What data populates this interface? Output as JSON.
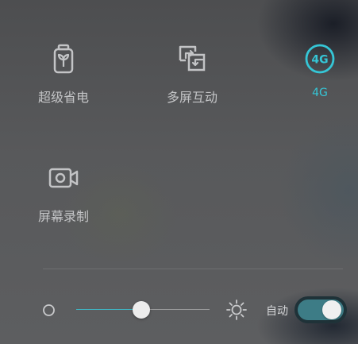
{
  "quick_settings": {
    "tiles": [
      {
        "label": "超级省电",
        "icon": "battery-leaf-icon",
        "active": false
      },
      {
        "label": "多屏互动",
        "icon": "screen-mirror-icon",
        "active": false
      },
      {
        "label": "4G",
        "icon": "4g-network-icon",
        "active": true
      },
      {
        "label": "屏幕录制",
        "icon": "screen-record-icon",
        "active": false
      }
    ],
    "active_color": "#35c6d6"
  },
  "brightness": {
    "level": 0.49,
    "auto_label": "自动",
    "auto_enabled": true,
    "low_icon": "brightness-low-icon",
    "high_icon": "brightness-high-icon"
  }
}
